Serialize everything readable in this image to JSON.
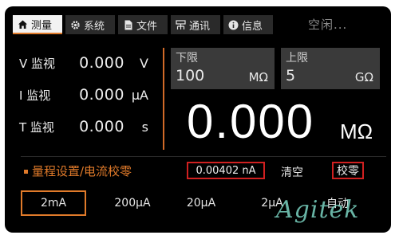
{
  "tabs": [
    {
      "label": "测量",
      "icon": "home-icon",
      "active": true
    },
    {
      "label": "系统",
      "icon": "gear-icon"
    },
    {
      "label": "文件",
      "icon": "document-icon"
    },
    {
      "label": "通讯",
      "icon": "network-icon"
    },
    {
      "label": "信息",
      "icon": "info-icon"
    }
  ],
  "status": "空闲...",
  "readings": [
    {
      "label": "V 监视",
      "value": "0.000",
      "unit": "V"
    },
    {
      "label": "I 监视",
      "value": "0.000",
      "unit": "μA"
    },
    {
      "label": "T 监视",
      "value": "0.000",
      "unit": "s"
    }
  ],
  "limits": {
    "lower": {
      "title": "下限",
      "value": "100",
      "unit": "MΩ"
    },
    "upper": {
      "title": "上限",
      "value": "5",
      "unit": "GΩ"
    }
  },
  "main_value": {
    "value": "0.000",
    "unit": "MΩ"
  },
  "range_panel": {
    "title": "量程设置/电流校零",
    "current": "0.00402 nA",
    "clear_label": "清空",
    "zero_label": "校零",
    "ranges": [
      "2mA",
      "200μA",
      "20μA",
      "2μA",
      "自动"
    ],
    "selected_range": "2mA"
  },
  "watermark": "Agitek",
  "colors": {
    "accent": "#e07a2a",
    "highlight_box": "#d02020",
    "background": "#000000"
  }
}
